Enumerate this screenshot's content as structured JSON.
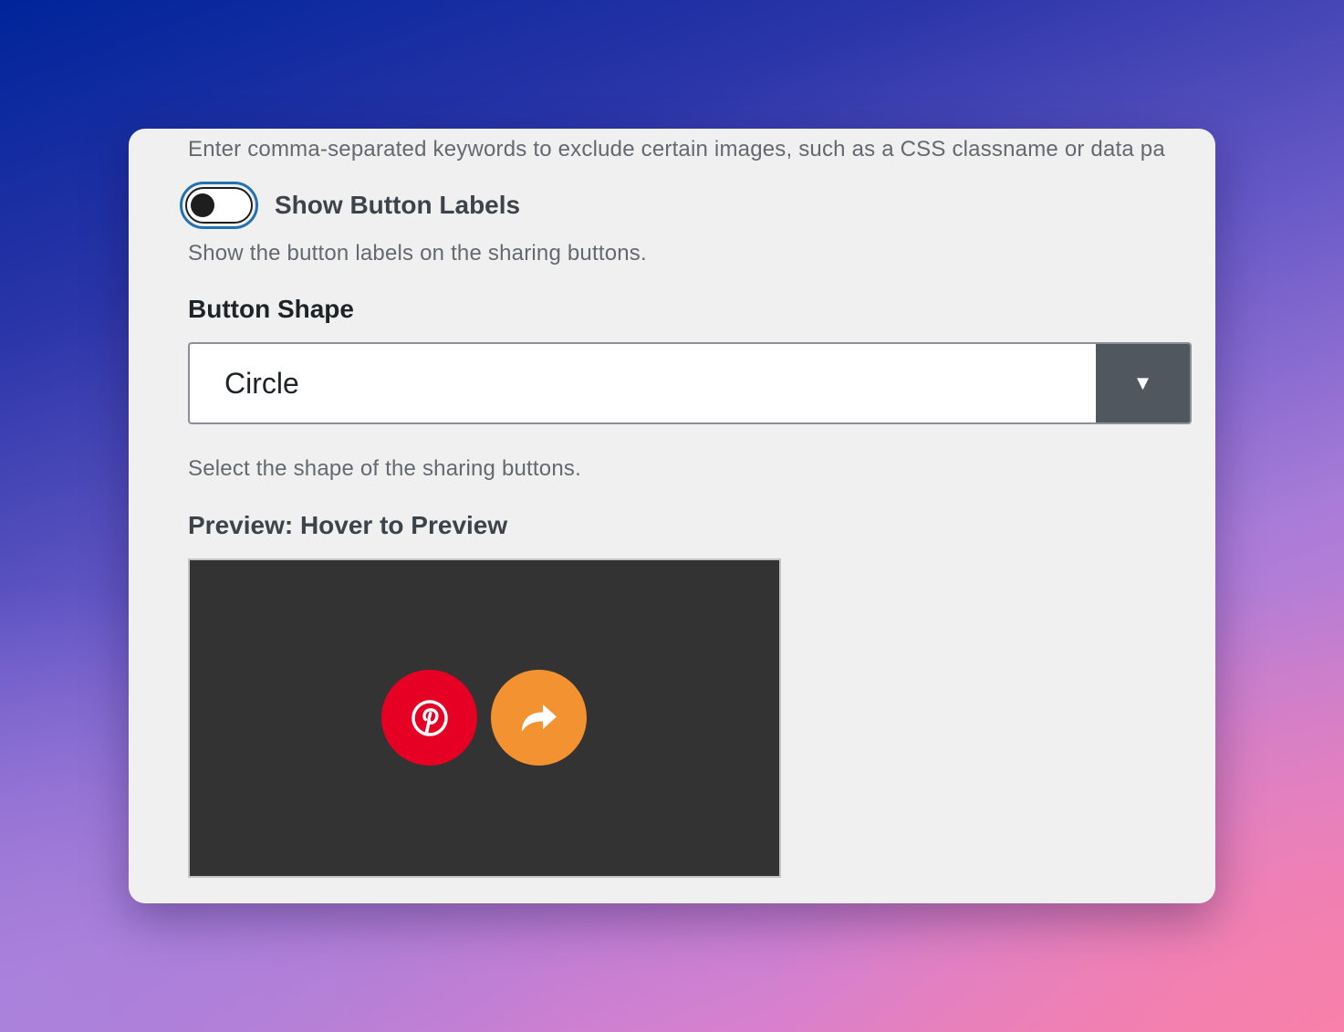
{
  "panel": {
    "exclude_help": "Enter comma-separated keywords to exclude certain images, such as a CSS classname or data pa",
    "labels_toggle": {
      "label": "Show Button Labels",
      "checked": false,
      "help": "Show the button labels on the sharing buttons."
    },
    "button_shape": {
      "label": "Button Shape",
      "selected": "Circle",
      "arrow": "▼",
      "help": "Select the shape of the sharing buttons."
    },
    "preview": {
      "label": "Preview: Hover to Preview",
      "buttons": [
        {
          "icon": "pinterest-icon",
          "color": "#e60023"
        },
        {
          "icon": "share-arrow-icon",
          "color": "#f29231"
        }
      ]
    }
  },
  "colors": {
    "panel_bg": "#f0f0f0",
    "focus_ring": "#2271b1",
    "preview_bg": "#333333",
    "select_arrow_bg": "#50575e"
  }
}
